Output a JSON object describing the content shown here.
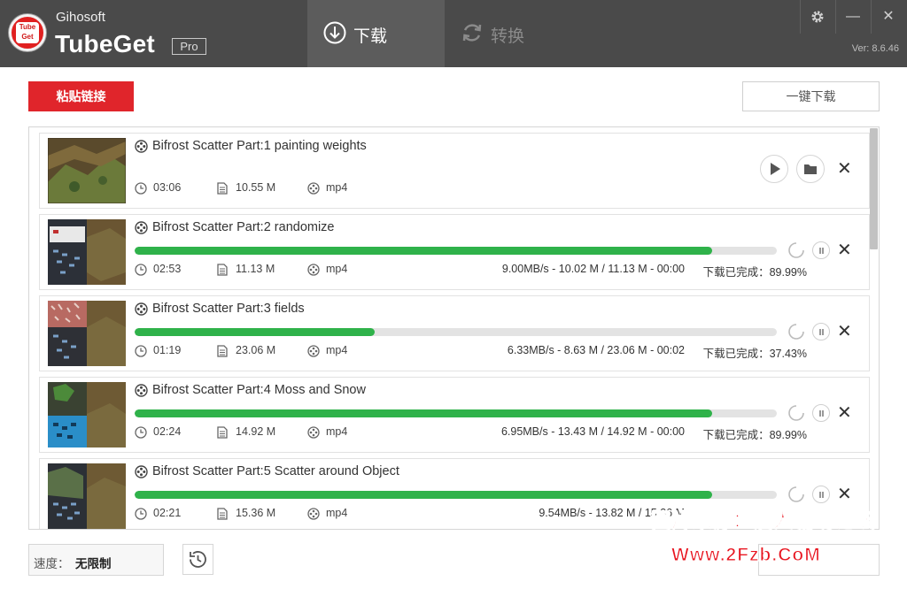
{
  "header": {
    "brand_small": "Gihosoft",
    "brand_big": "TubeGet",
    "badge": "Pro",
    "logo_text_1": "Tube",
    "logo_text_2": "Get",
    "version": "Ver: 8.6.46",
    "tabs": [
      {
        "label": "下载",
        "icon": "download-circle-icon",
        "active": true
      },
      {
        "label": "转换",
        "icon": "convert-refresh-icon",
        "active": false
      }
    ],
    "window_controls": [
      "gear-icon",
      "minimize-icon",
      "close-icon"
    ]
  },
  "toolbar": {
    "paste_label": "粘贴链接",
    "onekey_label": "一键下载"
  },
  "items": [
    {
      "title": "Bifrost Scatter Part:1 painting weights",
      "duration": "03:06",
      "size": "10.55 M",
      "format": "mp4",
      "status": "completed"
    },
    {
      "title": "Bifrost Scatter Part:2 randomize",
      "duration": "02:53",
      "size": "11.13 M",
      "format": "mp4",
      "progress": 0.8999,
      "speed_text": "9.00MB/s - 10.02 M / 11.13 M - 00:00",
      "done_text": "下载已完成：89.99%"
    },
    {
      "title": "Bifrost Scatter Part:3 fields",
      "duration": "01:19",
      "size": "23.06 M",
      "format": "mp4",
      "progress": 0.3743,
      "speed_text": "6.33MB/s - 8.63 M / 23.06 M - 00:02",
      "done_text": "下载已完成：37.43%"
    },
    {
      "title": "Bifrost Scatter Part:4 Moss and Snow",
      "duration": "02:24",
      "size": "14.92 M",
      "format": "mp4",
      "progress": 0.8999,
      "speed_text": "6.95MB/s - 13.43 M / 14.92 M - 00:00",
      "done_text": "下载已完成：89.99%"
    },
    {
      "title": "Bifrost Scatter Part:5 Scatter around Object",
      "duration": "02:21",
      "size": "15.36 M",
      "format": "mp4",
      "progress": 0.8999,
      "speed_text": "9.54MB/s - 13.82 M / 15.36 M"
    }
  ],
  "footer": {
    "speed_label": "速度：",
    "speed_value": "无限制"
  },
  "watermark": {
    "line1": "图片来源：酒人辅助论坛",
    "line2": "Www.2Fzb.CoM"
  },
  "colors": {
    "header_bg": "#4a4a4a",
    "accent_red": "#e0252b",
    "progress_green": "#2fb24a"
  }
}
